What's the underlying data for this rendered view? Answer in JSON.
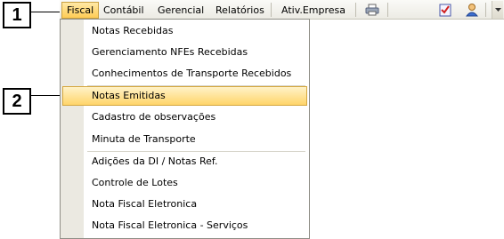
{
  "callouts": {
    "first": "1",
    "second": "2"
  },
  "menubar": {
    "items": [
      "Fiscal",
      "Contábil",
      "Gerencial",
      "Relatórios",
      "Ativ.Empresa"
    ],
    "active": "Fiscal"
  },
  "toolbar": {
    "icons": [
      "printer-icon",
      "checklist-icon",
      "user-icon",
      "chevron-down-icon"
    ]
  },
  "fiscal_menu": {
    "group1": [
      "Notas Recebidas",
      "Gerenciamento NFEs Recebidas",
      "Conhecimentos de Transporte Recebidos"
    ],
    "group2": [
      "Notas Emitidas",
      "Cadastro de observações",
      "Minuta de Transporte"
    ],
    "group3": [
      "Adições da DI / Notas Ref.",
      "Controle de Lotes",
      "Nota Fiscal Eletronica",
      "Nota Fiscal Eletronica - Serviços"
    ],
    "highlighted": "Notas Emitidas"
  },
  "colors": {
    "highlight": "#ffd56a",
    "menubar_bg": "#ecebe4",
    "gutter": "#ebe9e1"
  }
}
